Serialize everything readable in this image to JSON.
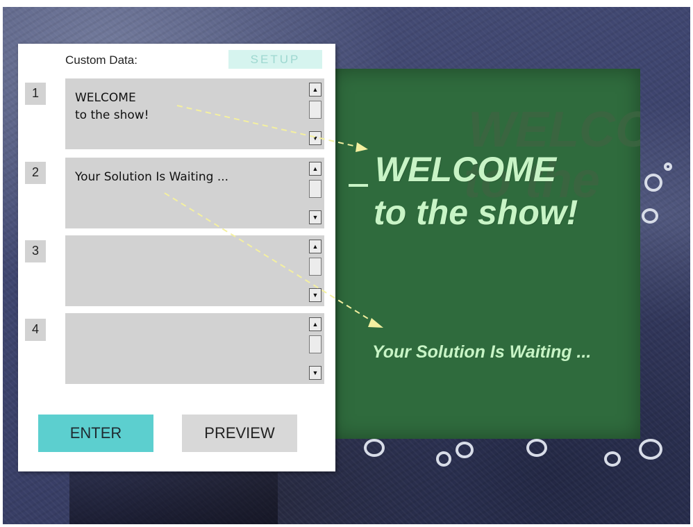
{
  "panel": {
    "custom_label": "Custom Data:",
    "setup_label": "SETUP",
    "rows": [
      {
        "number": "1",
        "text": "WELCOME\nto the show!"
      },
      {
        "number": "2",
        "text": "Your Solution Is Waiting ..."
      },
      {
        "number": "3",
        "text": ""
      },
      {
        "number": "4",
        "text": ""
      }
    ],
    "enter_label": "ENTER",
    "preview_label": "PREVIEW"
  },
  "board": {
    "ghost_line_1": "WELCO",
    "ghost_line_2": "to the",
    "headline_line_1": "WELCOME",
    "headline_line_2": "to the show!",
    "subline": "Your Solution Is Waiting ..."
  },
  "icons": {
    "scroll_up": "scroll-up-arrow",
    "scroll_down": "scroll-down-arrow"
  },
  "colors": {
    "board_green": "#2f6b3d",
    "headline_text": "#c8f4c6",
    "enter_button": "#5ccfcf",
    "setup_button": "#d6f4ef",
    "field_gray": "#d2d2d2",
    "arrow": "#f4f0a0"
  }
}
